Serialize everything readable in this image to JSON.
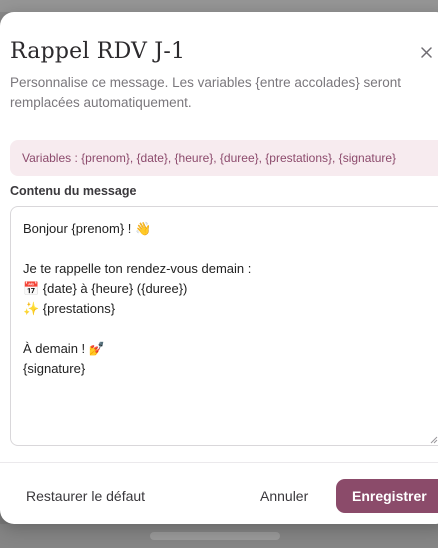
{
  "modal": {
    "title": "Rappel RDV J-1",
    "description": "Personnalise ce message. Les variables {entre accolades} seront remplacées automatiquement.",
    "variables_hint": "Variables : {prenom}, {date}, {heure}, {duree}, {prestations}, {signature}",
    "field_label": "Contenu du message",
    "message_value": "Bonjour {prenom} ! 👋\n\nJe te rappelle ton rendez-vous demain :\n📅 {date} à {heure} ({duree})\n✨ {prestations}\n\nÀ demain ! 💅\n{signature}",
    "close_icon": "close-icon"
  },
  "footer": {
    "restore_label": "Restaurer le défaut",
    "cancel_label": "Annuler",
    "save_label": "Enregistrer"
  },
  "colors": {
    "accent": "#8b4b6a",
    "variables_bg": "#f7ebef",
    "variables_text": "#8c4a6c"
  }
}
